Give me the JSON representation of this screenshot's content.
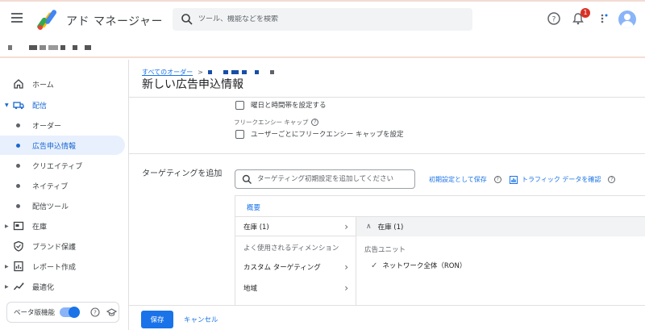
{
  "header": {
    "app_title": "アド マネージャー",
    "search_placeholder": "ツール、機能などを検索",
    "notification_count": "1",
    "icons": [
      "menu-icon",
      "help-icon",
      "notifications-icon",
      "apps-icon",
      "avatar"
    ]
  },
  "sidebar": {
    "items": [
      {
        "label": "ホーム",
        "icon": "home-icon"
      },
      {
        "label": "配信",
        "icon": "delivery-truck-icon"
      },
      {
        "label": "オーダー"
      },
      {
        "label": "広告申込情報"
      },
      {
        "label": "クリエイティブ"
      },
      {
        "label": "ネイティブ"
      },
      {
        "label": "配信ツール"
      },
      {
        "label": "在庫",
        "icon": "inventory-icon"
      },
      {
        "label": "ブランド保護",
        "icon": "shield-icon"
      },
      {
        "label": "レポート作成",
        "icon": "report-icon"
      },
      {
        "label": "最適化",
        "icon": "trend-icon"
      }
    ],
    "beta_label": "ベータ版機能"
  },
  "main": {
    "breadcrumb_link": "すべてのオーダー",
    "breadcrumb_sep": ">",
    "page_title": "新しい広告申込情報",
    "daypart_checkbox": "曜日と時間帯を設定する",
    "freq_cap_heading": "フリークエンシー キャップ",
    "freq_cap_checkbox": "ユーザーごとにフリークエンシー キャップを設定",
    "targeting_label": "ターゲティングを追加",
    "targeting_placeholder": "ターゲティング初期設定を追加してください",
    "save_as_default": "初期設定として保存",
    "view_traffic": "トラフィック データを確認",
    "overview_tab": "概要",
    "dimensions": {
      "inventory": "在庫 (1)",
      "common_heading": "よく使用されるディメンション",
      "custom": "カスタム ターゲティング",
      "geo": "地域"
    },
    "right_panel": {
      "header": "在庫 (1)",
      "sub_heading": "広告ユニット",
      "item": "ネットワーク全体（RON）"
    }
  },
  "footer": {
    "save": "保存",
    "cancel": "キャンセル"
  },
  "colors": {
    "accent": "#1a73e8",
    "active_bg": "#e8f0fe",
    "badge": "#d93025"
  }
}
